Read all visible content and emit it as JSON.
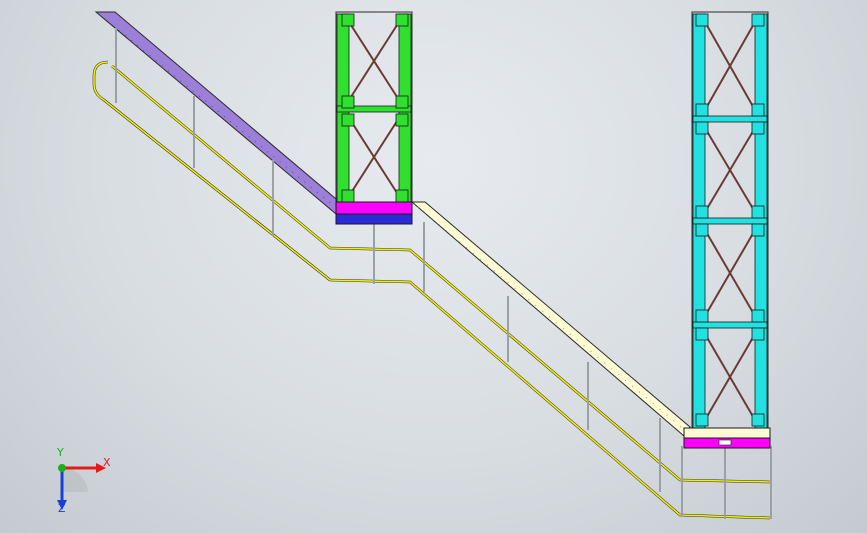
{
  "viewport": {
    "background_color": "#d6dbe0"
  },
  "model": {
    "left_stair_color": "#9b7fd8",
    "right_stair_color": "#fdfbd3",
    "handrail_color": "#f3f000",
    "post_color": "#9aa0a3",
    "left_tower_color": "#2fe02f",
    "right_tower_color": "#22e1e1",
    "brace_color": "#6a3b36",
    "landing_top_color": "#ff00ff",
    "landing_bottom_color": "#2a2ad6"
  },
  "triad": {
    "x_label": "X",
    "y_label": "Y",
    "z_label": "Z",
    "x_color": "#e11b1b",
    "y_color": "#18b318",
    "z_color": "#1b3fd6"
  }
}
